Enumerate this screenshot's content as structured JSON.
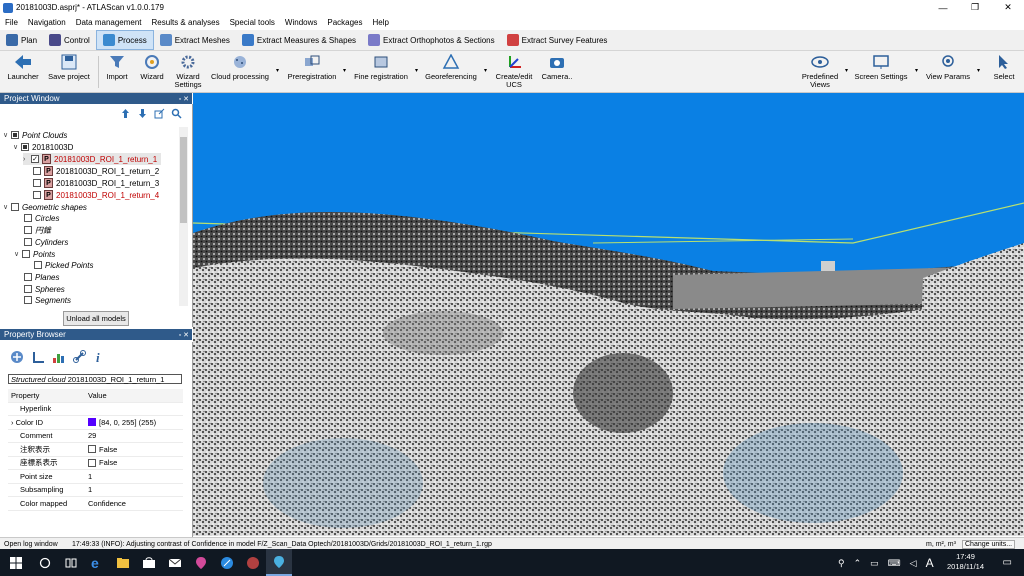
{
  "window": {
    "title": "20181003D.asprj* - ATLAScan v1.0.0.179",
    "minimize": "—",
    "maximize": "❐",
    "close": "✕"
  },
  "menu": [
    "File",
    "Navigation",
    "Data management",
    "Results & analyses",
    "Special tools",
    "Windows",
    "Packages",
    "Help"
  ],
  "tabs": [
    {
      "label": "Plan",
      "color": "#3a6aa8"
    },
    {
      "label": "Control",
      "color": "#4a4a8a"
    },
    {
      "label": "Process",
      "color": "#3a8ad0",
      "active": true
    },
    {
      "label": "Extract Meshes",
      "color": "#5a8ac8"
    },
    {
      "label": "Extract Measures & Shapes",
      "color": "#3a7ac8"
    },
    {
      "label": "Extract Orthophotos & Sections",
      "color": "#7a7ac8"
    },
    {
      "label": "Extract Survey Features",
      "color": "#d04040"
    }
  ],
  "ribbon": {
    "launcher": "Launcher",
    "save_project": "Save project",
    "import": "Import",
    "wizard": "Wizard",
    "wizard_settings": "Wizard Settings",
    "cloud_processing": "Cloud processing",
    "preregistration": "Preregistration",
    "fine_registration": "Fine registration",
    "georeferencing": "Georeferencing",
    "create_edit_ucs": "Create/edit UCS",
    "camera": "Camera..",
    "predefined_views": "Predefined Views",
    "screen_settings": "Screen Settings",
    "view_params": "View Params",
    "select": "Select"
  },
  "project_window": {
    "title": "Project Window",
    "tree": {
      "point_clouds": "Point Clouds",
      "group": "20181003D",
      "clouds": [
        {
          "label": "20181003D_ROI_1_return_1",
          "red": true,
          "checked": true
        },
        {
          "label": "20181003D_ROI_1_return_2",
          "red": false,
          "checked": false
        },
        {
          "label": "20181003D_ROI_1_return_3",
          "red": false,
          "checked": false
        },
        {
          "label": "20181003D_ROI_1_return_4",
          "red": true,
          "checked": false
        }
      ],
      "geometric_shapes": "Geometric shapes",
      "circles": "Circles",
      "enkan": "円錐",
      "cylinders": "Cylinders",
      "points": "Points",
      "picked_points": "Picked Points",
      "planes": "Planes",
      "spheres": "Spheres",
      "segments": "Segments"
    },
    "unload_all": "Unload all models"
  },
  "property_browser": {
    "title": "Property Browser",
    "selected_type": "Structured cloud",
    "selected_name": "20181003D_ROI_1_return_1",
    "col_property": "Property",
    "col_value": "Value",
    "rows": [
      {
        "key": "Hyperlink",
        "value": ""
      },
      {
        "key": "Color ID",
        "value": "[84, 0, 255] (255)",
        "swatch": "#5400ff"
      },
      {
        "key": "Comment",
        "value": "29"
      },
      {
        "key": "注釈表示",
        "value": "False",
        "checkbox": true
      },
      {
        "key": "座標系表示",
        "value": "False",
        "checkbox": true
      },
      {
        "key": "Point size",
        "value": "1"
      },
      {
        "key": "Subsampling",
        "value": "1"
      },
      {
        "key": "Color mapped",
        "value": "Confidence"
      }
    ]
  },
  "status": {
    "open_log": "Open log window",
    "message": "17:49:33 (INFO): Adjusting contrast of Confidence in model F/Z_Scan_Data Optech/20181003D/Grids/20181003D_ROI_1_return_1.rgp",
    "units": "m, m², m³",
    "change_units": "Change units..."
  },
  "taskbar": {
    "time": "17:49",
    "date": "2018/11/14",
    "ime": "A"
  }
}
